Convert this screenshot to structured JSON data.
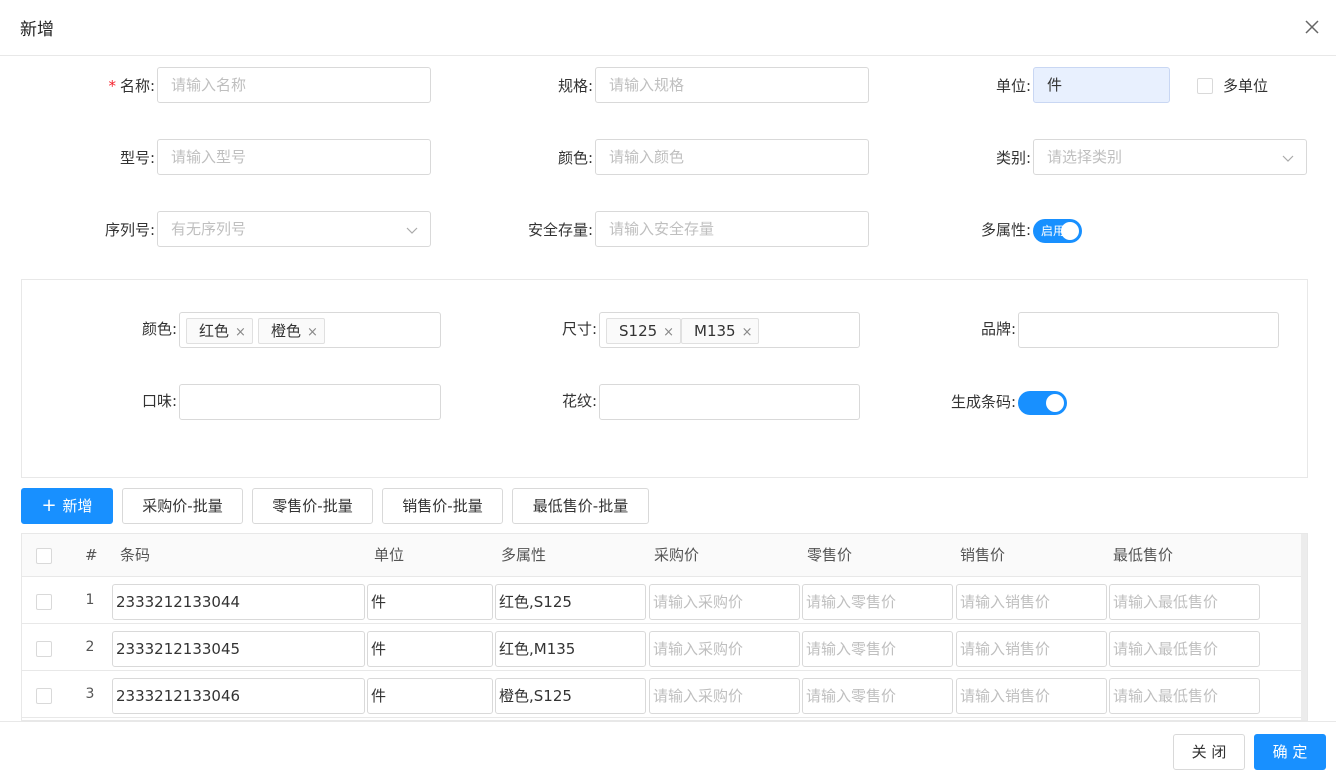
{
  "dialog": {
    "title": "新增"
  },
  "form": {
    "name": {
      "label": "名称:",
      "placeholder": "请输入名称"
    },
    "spec": {
      "label": "规格:",
      "placeholder": "请输入规格"
    },
    "unit": {
      "label": "单位:",
      "value": "件"
    },
    "multi_unit": {
      "label": "多单位",
      "checked": false
    },
    "model": {
      "label": "型号:",
      "placeholder": "请输入型号"
    },
    "color": {
      "label": "颜色:",
      "placeholder": "请输入颜色"
    },
    "category": {
      "label": "类别:",
      "placeholder": "请选择类别"
    },
    "serial": {
      "label": "序列号:",
      "placeholder": "有无序列号"
    },
    "safety_stock": {
      "label": "安全存量:",
      "placeholder": "请输入安全存量"
    },
    "multi_attr": {
      "label": "多属性:",
      "switch_text": "启用",
      "on": true
    }
  },
  "attributes": {
    "color": {
      "label": "颜色:",
      "tags": [
        "红色",
        "橙色"
      ]
    },
    "size": {
      "label": "尺寸:",
      "tags": [
        "S125",
        "M135"
      ]
    },
    "brand": {
      "label": "品牌:"
    },
    "flavor": {
      "label": "口味:"
    },
    "pattern": {
      "label": "花纹:"
    },
    "gen_barcode": {
      "label": "生成条码:",
      "on": true
    },
    "tag_close": "×"
  },
  "toolbar": {
    "add": "新增",
    "batch_purchase": "采购价-批量",
    "batch_retail": "零售价-批量",
    "batch_sale": "销售价-批量",
    "batch_min_sale": "最低售价-批量"
  },
  "table": {
    "columns": [
      "#",
      "条码",
      "单位",
      "多属性",
      "采购价",
      "零售价",
      "销售价",
      "最低售价"
    ],
    "placeholders": {
      "purchase": "请输入采购价",
      "retail": "请输入零售价",
      "sale": "请输入销售价",
      "min_sale": "请输入最低售价"
    },
    "rows": [
      {
        "index": "1",
        "barcode": "2333212133044",
        "unit": "件",
        "attr": "红色,S125"
      },
      {
        "index": "2",
        "barcode": "2333212133045",
        "unit": "件",
        "attr": "红色,M135"
      },
      {
        "index": "3",
        "barcode": "2333212133046",
        "unit": "件",
        "attr": "橙色,S125"
      }
    ]
  },
  "footer": {
    "close": "关 闭",
    "confirm": "确 定"
  },
  "colors": {
    "primary": "#1890ff",
    "required": "#f5222d",
    "unit_bg": "#e8f0fe"
  }
}
